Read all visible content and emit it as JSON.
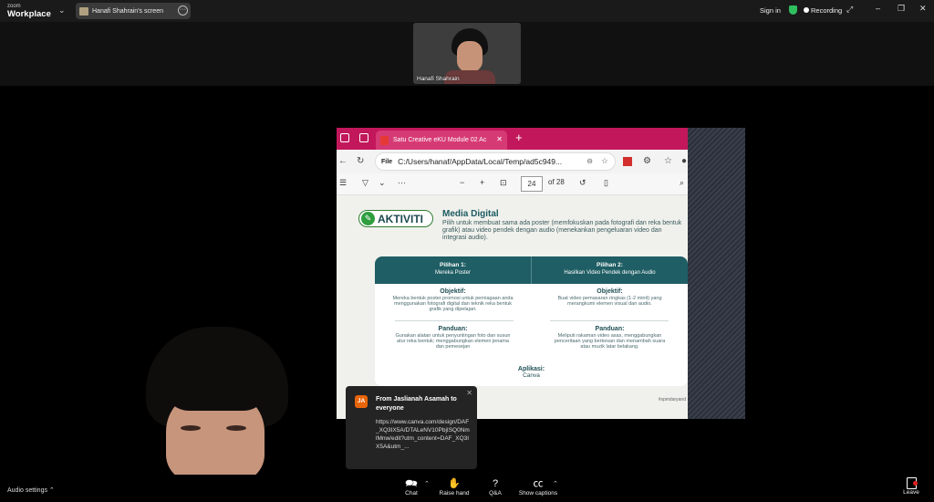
{
  "app": {
    "brand_top": "zoom",
    "brand_name": "Workplace",
    "share_label": "Hanafi Shahrain's screen",
    "sign_in": "Sign in",
    "recording": "Recording"
  },
  "participant": {
    "name": "Hanafi Shahrain"
  },
  "browser": {
    "tab_title": "Satu Creative eKU Module 02 Ac",
    "url_prefix": "File",
    "url": "C:/Users/hanaf/AppData/Local/Temp/ad5c949...",
    "page_current": "24",
    "page_total": "of 28"
  },
  "document": {
    "badge": "AKTIVITI",
    "title": "Media Digital",
    "description": "Pilih untuk membuat sama ada poster (memfokuskan pada fotografi dan reka bentuk grafik) atau video pendek dengan audio (menekankan pengeluaran video dan integrasi audio).",
    "col1_title": "Pilihan 1:",
    "col1_sub": "Mereka Poster",
    "col2_title": "Pilihan 2:",
    "col2_sub": "Hasilkan Video Pendek dengan Audio",
    "obj_heading": "Objektif:",
    "obj1": "Mereka bentuk poster promosi untuk perniagaan anda menggunakan fotografi digital dan teknik reka bentuk grafik yang dipelajari.",
    "obj2": "Buat video pemasaran ringkas (1-2 minit) yang merangkumi elemen visual dan audio.",
    "guide_heading": "Panduan:",
    "guide1": "Gunakan alatan untuk penyuntingan foto dan susun atur reka bentuk; menggabungkan elemen jenama dan pemesejan",
    "guide2": "Meliputi rakaman video asas, menggabungkan penceritaan yang berkesan dan menambah suara atau muzik latar belakang.",
    "app_heading": "Aplikasi:",
    "app_value": "Canva",
    "footer": "#spmdaryand"
  },
  "chat": {
    "initials": "JA",
    "from": "From Jaslianah Asamah to everyone",
    "message": "https://www.canva.com/design/DAF_XQ3IX5A/DTALeNV10PbjISQ0NmlMnw/edit?utm_content=DAF_XQ3IX5A&utm_..."
  },
  "toolbar": {
    "audio_settings": "Audio settings",
    "chat": "Chat",
    "raise_hand": "Raise hand",
    "qa": "Q&A",
    "captions": "Show captions",
    "leave": "Leave"
  },
  "colors": {
    "tab_bar": "#c2185b",
    "accent_teal": "#1f5e64",
    "recording_shield": "#2fbf5f",
    "chat_avatar": "#e8650a"
  }
}
